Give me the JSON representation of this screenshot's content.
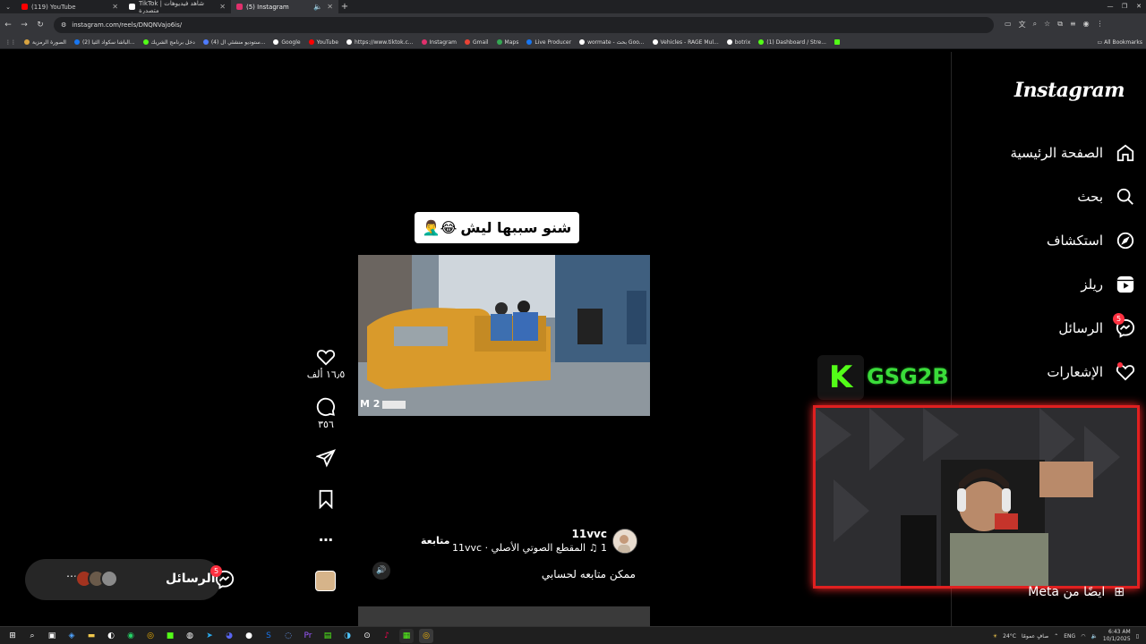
{
  "browser": {
    "tabs": [
      {
        "label": "(119) YouTube",
        "color": "#ff0000",
        "active": false
      },
      {
        "label": "TikTok | شاهد فيديوهات متصدرة",
        "color": "#ffffff",
        "active": false
      },
      {
        "label": "(5) Instagram",
        "color": "#e1306c",
        "active": true
      }
    ],
    "url": "instagram.com/reels/DNQNVajo6is/",
    "bookmarks": [
      {
        "label": "الصورة الرمزية",
        "color": "#d9a441"
      },
      {
        "label": "(2) الباشا سكواد الثيا...",
        "color": "#1877f2"
      },
      {
        "label": "دخل برنامج الشريك",
        "color": "#53fc18"
      },
      {
        "label": "(4) ستوديو منشئي ال...",
        "color": "#4f7cff"
      },
      {
        "label": "Google",
        "color": "#ffffff"
      },
      {
        "label": "YouTube",
        "color": "#ff0000"
      },
      {
        "label": "https://www.tiktok.c...",
        "color": "#ffffff"
      },
      {
        "label": "Instagram",
        "color": "#e1306c"
      },
      {
        "label": "Gmail",
        "color": "#ea4335"
      },
      {
        "label": "Maps",
        "color": "#34a853"
      },
      {
        "label": "Live Producer",
        "color": "#1877f2"
      },
      {
        "label": "wormate - بحث Goo...",
        "color": "#ffffff"
      },
      {
        "label": "Vehicles - RAGE Mul...",
        "color": "#ffffff"
      },
      {
        "label": "botrix",
        "color": "#ffffff"
      },
      {
        "label": "(1) Dashboard / Stre...",
        "color": "#53fc18"
      }
    ],
    "all_bookmarks": "All Bookmarks"
  },
  "instagram": {
    "logo": "Instagram",
    "nav": [
      {
        "label": "الصفحة الرئيسية",
        "icon": "home-icon"
      },
      {
        "label": "بحث",
        "icon": "search-icon"
      },
      {
        "label": "استكشاف",
        "icon": "explore-icon"
      },
      {
        "label": "ريلز",
        "icon": "reels-icon"
      },
      {
        "label": "الرسائل",
        "icon": "messenger-icon",
        "badge": "5"
      },
      {
        "label": "الإشعارات",
        "icon": "heart-icon",
        "dot": true
      }
    ],
    "also_from_meta": "ايضًا من Meta"
  },
  "reel": {
    "caption_text": "شنو سببها ليش",
    "caption_emoji": "😂🤦‍♂️",
    "likes": "١٦٫٥ ألف",
    "comments": "٣٥٦",
    "author": "11vvc",
    "audio": "المقطع الصوتي الأصلي · 11vvc",
    "audio_count": "1",
    "follow": "متابعة",
    "description": "ممكن متابعه لحسابي",
    "video_timestamp": "M 2"
  },
  "messages_pill": {
    "label": "الرسائل",
    "badge": "5"
  },
  "stream_overlay": {
    "badge_letter": "K",
    "name": "GSG2B"
  },
  "taskbar": {
    "weather": "24°C",
    "weather_note": "صافٍ عمومًا",
    "lang": "ENG",
    "time": "6:43 AM",
    "date": "10/1/2025"
  }
}
